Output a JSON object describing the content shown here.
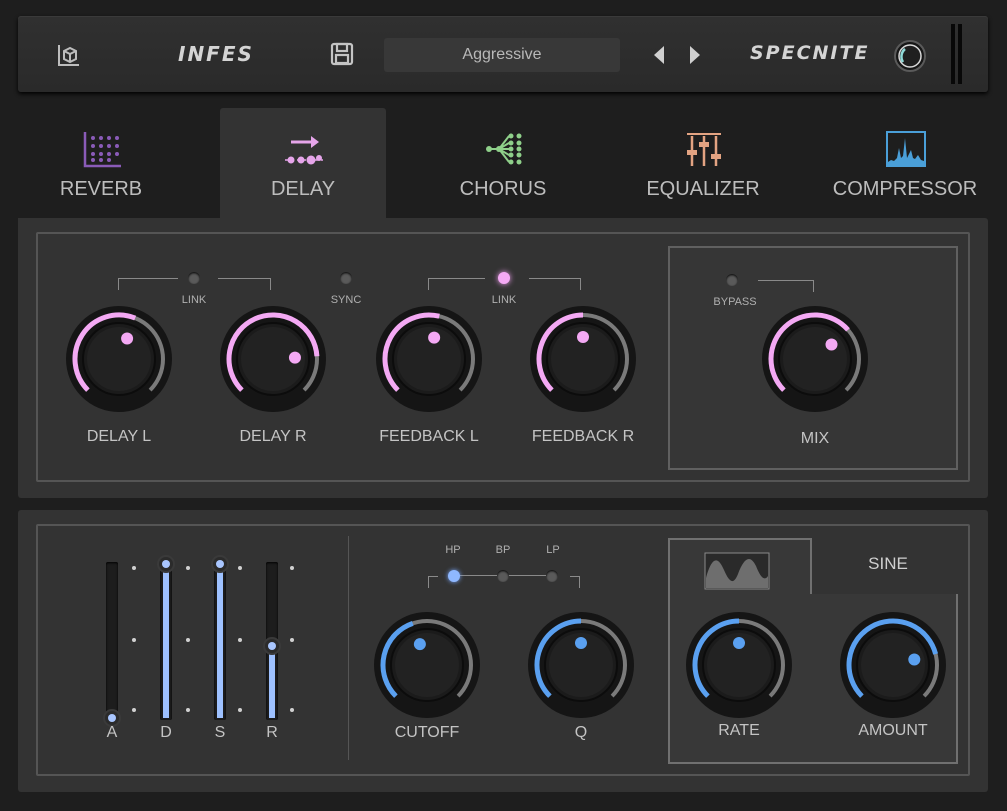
{
  "header": {
    "brand_left": "INFES",
    "brand_right": "SPECNITE",
    "preset_name": "Aggressive",
    "icons": [
      "box-icon",
      "save-icon",
      "prev-arrow-icon",
      "next-arrow-icon",
      "output-knob-icon"
    ]
  },
  "tabs": [
    {
      "label": "REVERB",
      "icon": "reverb-grid-icon",
      "color": "#8a5bb8",
      "active": false
    },
    {
      "label": "DELAY",
      "icon": "delay-arrow-icon",
      "color": "#e6a5ea",
      "active": true
    },
    {
      "label": "CHORUS",
      "icon": "chorus-tree-icon",
      "color": "#8fd08a",
      "active": false
    },
    {
      "label": "EQUALIZER",
      "icon": "eq-faders-icon",
      "color": "#e3a382",
      "active": false
    },
    {
      "label": "COMPRESSOR",
      "icon": "compressor-spectrum-icon",
      "color": "#4a9fd8",
      "active": false
    }
  ],
  "delay": {
    "link1_label": "LINK",
    "sync_label": "SYNC",
    "link2_label": "LINK",
    "bypass_label": "BYPASS",
    "link1_on": false,
    "sync_on": false,
    "link2_on": true,
    "bypass_on": false,
    "knobs": [
      {
        "label": "DELAY L",
        "value": 0.58
      },
      {
        "label": "DELAY R",
        "value": 0.82
      },
      {
        "label": "FEEDBACK L",
        "value": 0.55
      },
      {
        "label": "FEEDBACK R",
        "value": 0.5
      },
      {
        "label": "MIX",
        "value": 0.68
      }
    ],
    "accent": "#f4a9f4"
  },
  "envelope": {
    "labels": {
      "a": "A",
      "d": "D",
      "s": "S",
      "r": "R"
    },
    "values": {
      "a": 0.0,
      "d": 1.0,
      "s": 1.0,
      "r": 0.47
    },
    "accent": "#9ec1ff"
  },
  "filter": {
    "hp_label": "HP",
    "bp_label": "BP",
    "lp_label": "LP",
    "selected": "HP",
    "cutoff_label": "CUTOFF",
    "q_label": "Q",
    "cutoff_value": 0.43,
    "q_value": 0.5
  },
  "lfo": {
    "shape_icon": "sine-wave-icon",
    "shape_label": "SINE",
    "rate_label": "RATE",
    "amount_label": "AMOUNT",
    "rate_value": 0.5,
    "amount_value": 0.78
  }
}
